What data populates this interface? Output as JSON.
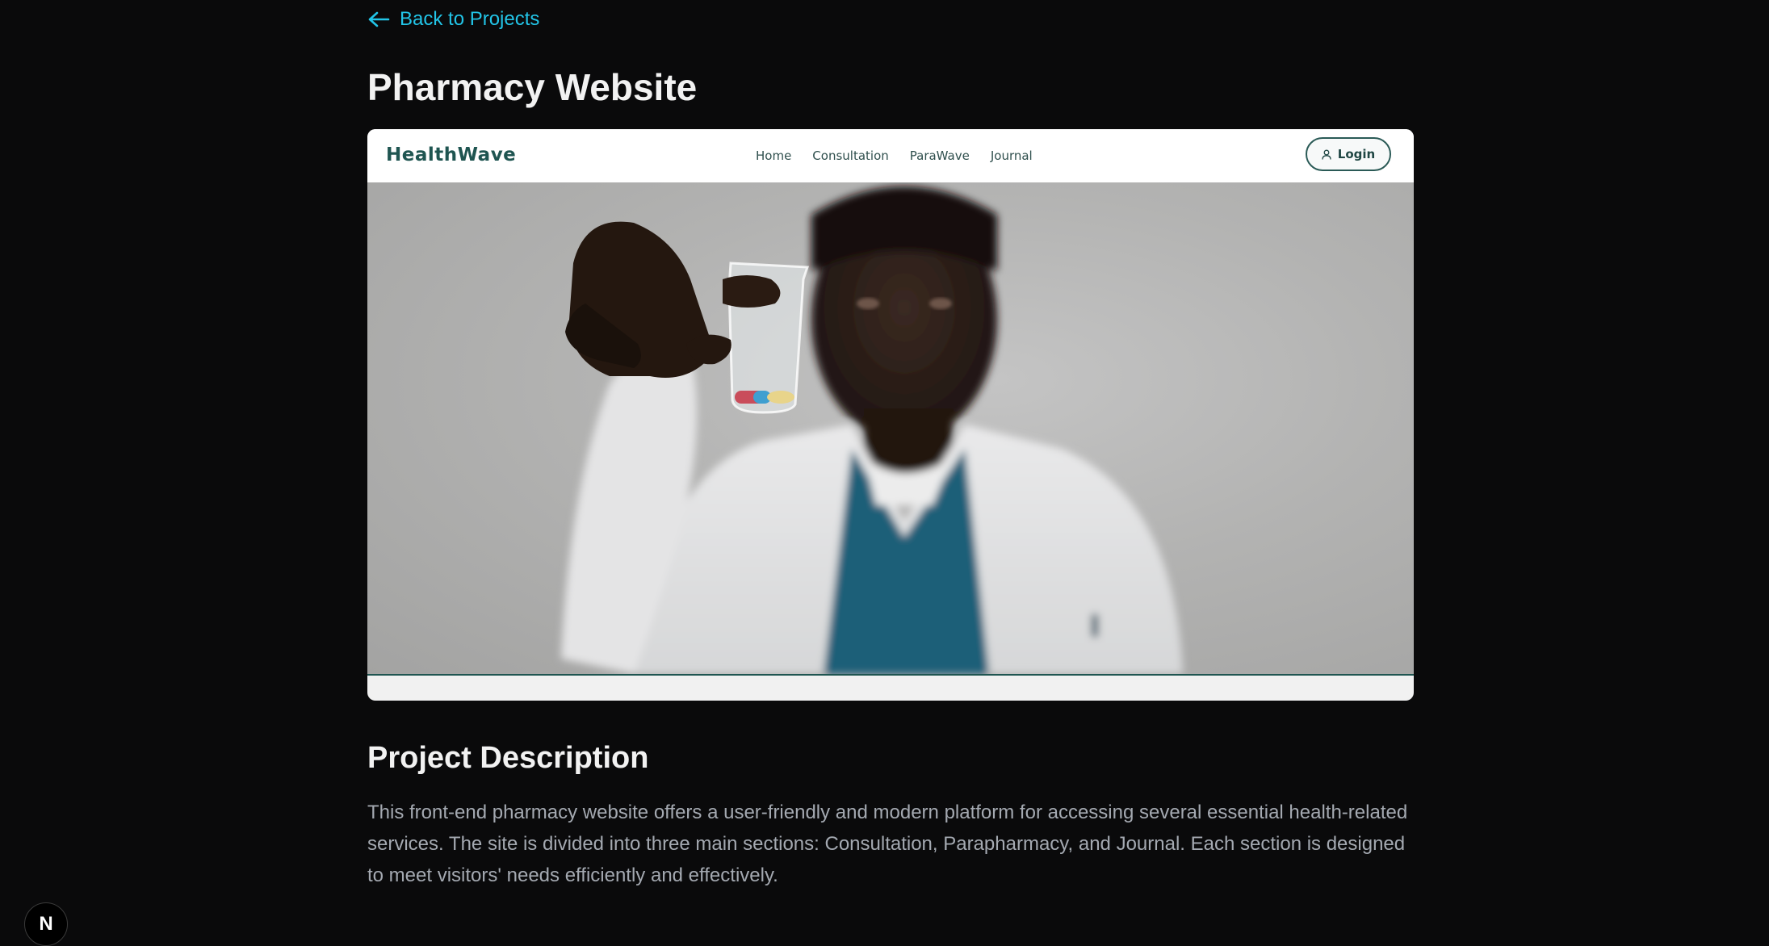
{
  "nav": {
    "back_label": "Back to Projects"
  },
  "page": {
    "title": "Pharmacy Website"
  },
  "preview": {
    "logo": "HealthWave",
    "menu": [
      "Home",
      "Consultation",
      "ParaWave",
      "Journal"
    ],
    "login_label": "Login"
  },
  "description": {
    "heading": "Project Description",
    "text": "This front-end pharmacy website offers a user-friendly and modern platform for accessing several essential health-related services. The site is divided into three main sections: Consultation, Parapharmacy, and Journal. Each section is designed to meet visitors' needs efficiently and effectively."
  },
  "badge": {
    "letter": "N"
  },
  "colors": {
    "background": "#0a0a0b",
    "accent": "#22c5e8",
    "brand": "#1f5551",
    "body_text": "#a4a9b1"
  }
}
